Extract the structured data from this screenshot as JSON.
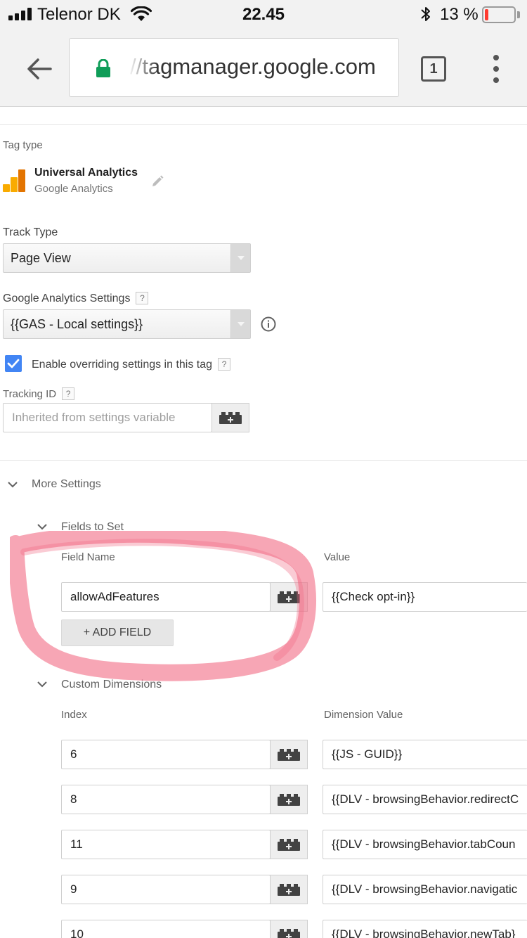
{
  "status_bar": {
    "carrier": "Telenor DK",
    "time": "22.45",
    "battery_percent": "13 %",
    "battery_level": 0.13
  },
  "browser": {
    "url": "//tagmanager.google.com",
    "tab_count": "1"
  },
  "tag": {
    "tag_type_label": "Tag type",
    "name": "Universal Analytics",
    "provider": "Google Analytics",
    "track_type_label": "Track Type",
    "track_type_value": "Page View",
    "ga_settings_label": "Google Analytics Settings",
    "ga_settings_value": "{{GAS - Local settings}}",
    "override_label": "Enable overriding settings in this tag",
    "override_checked": true,
    "tracking_id_label": "Tracking ID",
    "tracking_id_placeholder": "Inherited from settings variable"
  },
  "more_settings": {
    "title": "More Settings",
    "fields_to_set": {
      "title": "Fields to Set",
      "col_field_name": "Field Name",
      "col_value": "Value",
      "rows": [
        {
          "field": "allowAdFeatures",
          "value": "{{Check opt-in}}"
        }
      ],
      "add_field_label": "+ ADD FIELD"
    },
    "custom_dimensions": {
      "title": "Custom Dimensions",
      "col_index": "Index",
      "col_value": "Dimension Value",
      "rows": [
        {
          "index": "6",
          "value": "{{JS - GUID}}"
        },
        {
          "index": "8",
          "value": "{{DLV - browsingBehavior.redirectC"
        },
        {
          "index": "11",
          "value": "{{DLV - browsingBehavior.tabCoun"
        },
        {
          "index": "9",
          "value": "{{DLV - browsingBehavior.navigatic"
        },
        {
          "index": "10",
          "value": "{{DLV - browsingBehavior.newTab}"
        }
      ]
    }
  },
  "colors": {
    "checkbox_blue": "#4285f4",
    "highlight_red": "#f26b83",
    "lock_green": "#0f9d58"
  }
}
